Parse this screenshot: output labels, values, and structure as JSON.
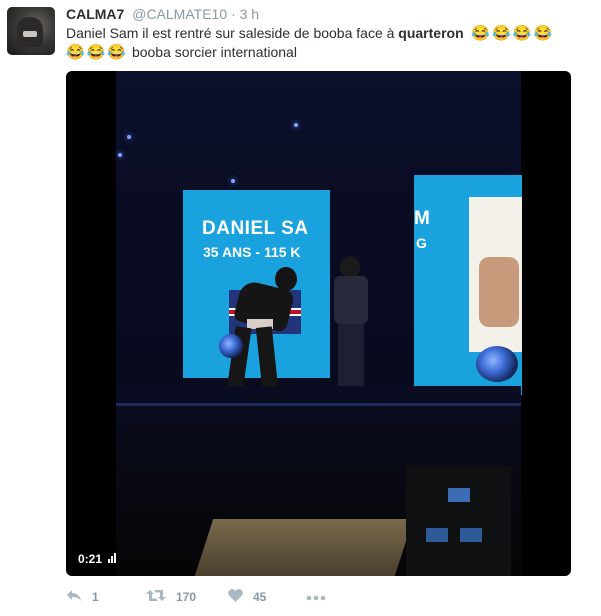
{
  "user": {
    "name": "CALMA7",
    "handle": "@CALMATE10",
    "separator": "·",
    "time": "3 h"
  },
  "tweet": {
    "text_part1": "Daniel Sam il est rentré sur saleside de booba face à ",
    "text_bold": "quarteron",
    "emoji": "😂",
    "text_part2": "booba sorcier international"
  },
  "video": {
    "screen_title": "DANIEL SA",
    "screen_sub": "35 ANS - 115 K",
    "screen_right_title": "M",
    "screen_right_sub": "G",
    "time": "0:21"
  },
  "actions": {
    "reply_count": "1",
    "retweet_count": "170",
    "like_count": "45"
  },
  "icons": {
    "reply": "reply-icon",
    "retweet": "retweet-icon",
    "like": "heart-icon",
    "more": "more-icon"
  },
  "colors": {
    "text": "#292f33",
    "muted": "#8899a6",
    "stage_screen": "#1aa2de"
  }
}
